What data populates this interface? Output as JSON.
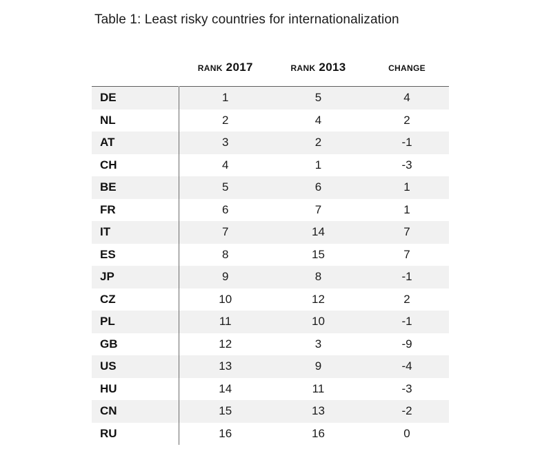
{
  "caption": "Table 1: Least risky countries for internationalization",
  "table": {
    "columns": [
      {
        "key": "country",
        "label": ""
      },
      {
        "key": "rank_2017",
        "label": "Rank 2017"
      },
      {
        "key": "rank_2013",
        "label": "Rank 2013"
      },
      {
        "key": "change",
        "label": "Change"
      }
    ],
    "rows": [
      {
        "country": "DE",
        "rank_2017": "1",
        "rank_2013": "5",
        "change": "4"
      },
      {
        "country": "NL",
        "rank_2017": "2",
        "rank_2013": "4",
        "change": "2"
      },
      {
        "country": "AT",
        "rank_2017": "3",
        "rank_2013": "2",
        "change": "-1"
      },
      {
        "country": "CH",
        "rank_2017": "4",
        "rank_2013": "1",
        "change": "-3"
      },
      {
        "country": "BE",
        "rank_2017": "5",
        "rank_2013": "6",
        "change": "1"
      },
      {
        "country": "FR",
        "rank_2017": "6",
        "rank_2013": "7",
        "change": "1"
      },
      {
        "country": "IT",
        "rank_2017": "7",
        "rank_2013": "14",
        "change": "7"
      },
      {
        "country": "ES",
        "rank_2017": "8",
        "rank_2013": "15",
        "change": "7"
      },
      {
        "country": "JP",
        "rank_2017": "9",
        "rank_2013": "8",
        "change": "-1"
      },
      {
        "country": "CZ",
        "rank_2017": "10",
        "rank_2013": "12",
        "change": "2"
      },
      {
        "country": "PL",
        "rank_2017": "11",
        "rank_2013": "10",
        "change": "-1"
      },
      {
        "country": "GB",
        "rank_2017": "12",
        "rank_2013": "3",
        "change": "-9"
      },
      {
        "country": "US",
        "rank_2017": "13",
        "rank_2013": "9",
        "change": "-4"
      },
      {
        "country": "HU",
        "rank_2017": "14",
        "rank_2013": "11",
        "change": "-3"
      },
      {
        "country": "CN",
        "rank_2017": "15",
        "rank_2013": "13",
        "change": "-2"
      },
      {
        "country": "RU",
        "rank_2017": "16",
        "rank_2013": "16",
        "change": "0"
      }
    ]
  },
  "colors": {
    "page_background": "#ffffff",
    "row_shaded": "#f1f1f1",
    "row_plain": "#ffffff",
    "rule": "#5d5d5d",
    "text": "#1a1a1a"
  }
}
